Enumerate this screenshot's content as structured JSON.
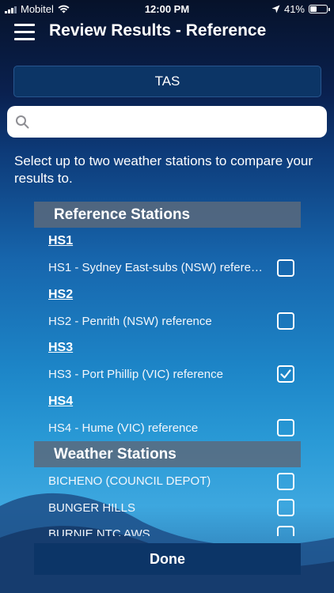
{
  "status_bar": {
    "carrier": "Mobitel",
    "time": "12:00 PM",
    "battery": "41%",
    "battery_level": 0.41
  },
  "header": {
    "title": "Review Results - Reference",
    "menu_icon": "hamburger-menu-icon"
  },
  "state_button": {
    "label": "TAS"
  },
  "search": {
    "value": "",
    "placeholder": "",
    "icon": "search-icon"
  },
  "instructions": "Select up to two weather stations to compare your results to.",
  "reference_section": {
    "title": "Reference Stations",
    "groups": [
      {
        "heading": "HS1",
        "label": "HS1 - Sydney East-subs (NSW) reference",
        "checked": false
      },
      {
        "heading": "HS2",
        "label": "HS2 - Penrith (NSW) reference",
        "checked": false
      },
      {
        "heading": "HS3",
        "label": "HS3 - Port Phillip (VIC) reference",
        "checked": true
      },
      {
        "heading": "HS4",
        "label": "HS4 - Hume (VIC) reference",
        "checked": false
      }
    ]
  },
  "weather_section": {
    "title": "Weather Stations",
    "items": [
      {
        "label": "BICHENO (COUNCIL DEPOT)",
        "checked": false
      },
      {
        "label": "BUNGER HILLS",
        "checked": false
      },
      {
        "label": "BURNIE NTC AWS",
        "checked": false
      }
    ]
  },
  "done_button": {
    "label": "Done"
  },
  "colors": {
    "accent_button": "#0c3567",
    "section_header": "#5a6a7c",
    "search_background": "#ffffff"
  }
}
